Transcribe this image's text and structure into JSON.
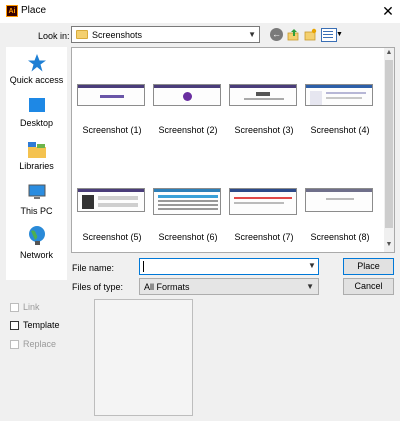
{
  "window": {
    "title": "Place",
    "app_icon_text": "Ai"
  },
  "look_in": {
    "label": "Look in:",
    "value": "Screenshots"
  },
  "places": [
    {
      "label": "Quick access",
      "icon": "star-icon"
    },
    {
      "label": "Desktop",
      "icon": "desktop-icon"
    },
    {
      "label": "Libraries",
      "icon": "libraries-icon"
    },
    {
      "label": "This PC",
      "icon": "computer-icon"
    },
    {
      "label": "Network",
      "icon": "network-icon"
    }
  ],
  "files": [
    "Screenshot (1)",
    "Screenshot (2)",
    "Screenshot (3)",
    "Screenshot (4)",
    "Screenshot (5)",
    "Screenshot (6)",
    "Screenshot (7)",
    "Screenshot (8)"
  ],
  "file_name": {
    "label": "File name:",
    "value": ""
  },
  "file_type": {
    "label": "Files of type:",
    "value": "All Formats"
  },
  "buttons": {
    "place": "Place",
    "cancel": "Cancel"
  },
  "options": [
    {
      "label": "Link",
      "checked": false,
      "enabled": false
    },
    {
      "label": "Template",
      "checked": false,
      "enabled": true
    },
    {
      "label": "Replace",
      "checked": false,
      "enabled": false
    }
  ],
  "colors": {
    "accent": "#0078d7",
    "app_icon_bg": "#330000",
    "app_icon_fg": "#ff9a00",
    "folder": "#f4d06f"
  }
}
